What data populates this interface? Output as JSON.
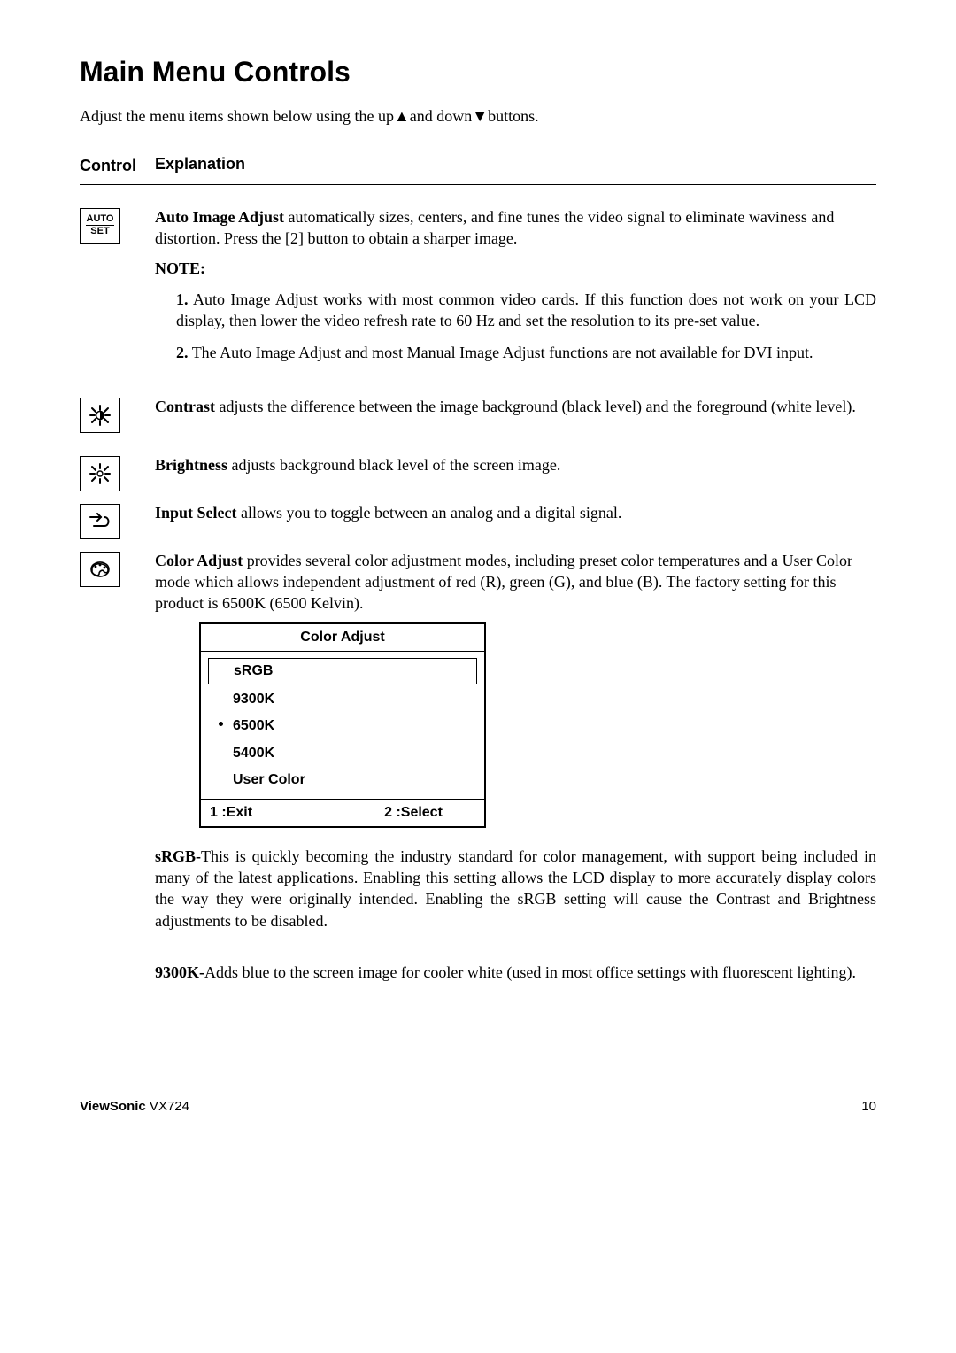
{
  "title": "Main Menu Controls",
  "intro": "Adjust the menu items shown below using the up▲and down▼buttons.",
  "header": {
    "control": "Control",
    "explanation": "Explanation"
  },
  "autoset": {
    "icon_line1": "AUTO",
    "icon_line2": "SET",
    "lead": "Auto Image Adjust",
    "text": " automatically sizes, centers, and fine tunes the video signal to eliminate waviness and distortion. Press the [2] button to obtain a sharper image.",
    "note_label": "NOTE:",
    "note1": "Auto Image Adjust works with most common video cards. If this function does not work on your LCD display, then lower the video refresh rate to 60 Hz and set the resolution to its pre-set value.",
    "note2": "The Auto Image Adjust and most Manual Image Adjust functions are not available for DVI input."
  },
  "contrast": {
    "lead": "Contrast",
    "text": " adjusts the difference between the image background  (black level) and the foreground (white level)."
  },
  "brightness": {
    "lead": "Brightness",
    "text": " adjusts background black level of the screen image."
  },
  "input_select": {
    "lead": "Input Select",
    "text": " allows you to toggle between an analog and a digital signal."
  },
  "color_adjust": {
    "lead": "Color Adjust",
    "text": " provides several color adjustment modes, including preset color temperatures and a User Color mode which allows independent adjustment of red (R), green (G), and blue (B). The factory setting for this product is 6500K (6500 Kelvin)."
  },
  "color_box": {
    "title": "Color Adjust",
    "items": [
      "sRGB",
      "9300K",
      "6500K",
      "5400K",
      "User Color"
    ],
    "exit": "1 :Exit",
    "select": "2 :Select"
  },
  "srgb": {
    "lead": "sRGB-",
    "text": "This is quickly becoming the industry standard for color management, with support being included in many of the latest applications. Enabling this setting allows the LCD display to more accurately display colors the way they were originally intended. Enabling the sRGB setting will cause the Contrast and Brightness adjustments to be disabled."
  },
  "k9300": {
    "lead": "9300K-",
    "text": "Adds blue to the screen image for cooler white (used in most office settings with fluorescent lighting)."
  },
  "footer": {
    "brand": "ViewSonic",
    "model": "  VX724",
    "page": "10"
  }
}
